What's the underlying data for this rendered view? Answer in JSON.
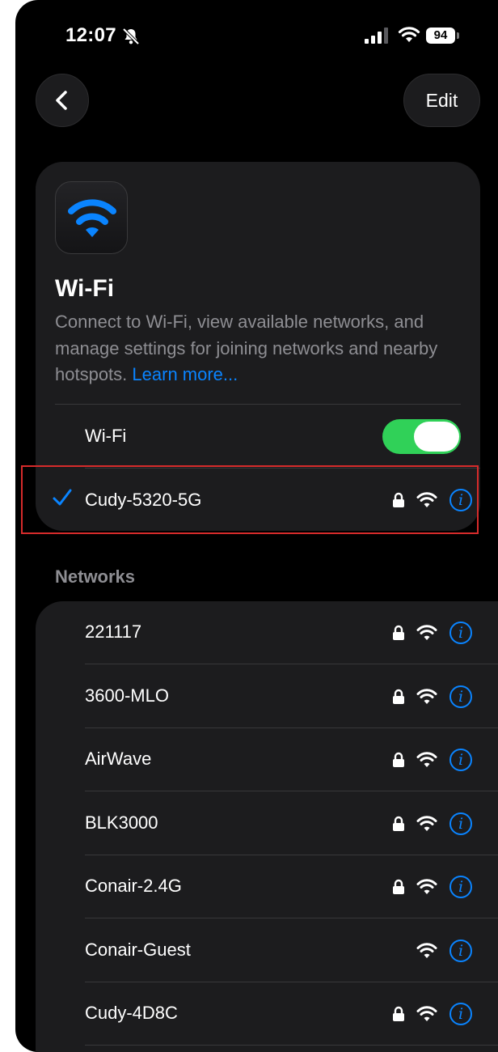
{
  "status_bar": {
    "time": "12:07",
    "battery": "94"
  },
  "nav": {
    "edit_label": "Edit"
  },
  "header_card": {
    "title": "Wi-Fi",
    "description": "Connect to Wi-Fi, view available networks, and manage settings for joining networks and nearby hotspots.",
    "learn_more": "Learn more...",
    "toggle_label": "Wi-Fi",
    "toggle_on": true,
    "connected_network": "Cudy-5320-5G"
  },
  "networks_section": {
    "header": "Networks",
    "items": [
      {
        "name": "221117",
        "locked": true
      },
      {
        "name": "3600-MLO",
        "locked": true
      },
      {
        "name": "AirWave",
        "locked": true
      },
      {
        "name": "BLK3000",
        "locked": true
      },
      {
        "name": "Conair-2.4G",
        "locked": true
      },
      {
        "name": "Conair-Guest",
        "locked": false
      },
      {
        "name": "Cudy-4D8C",
        "locked": true
      }
    ]
  },
  "colors": {
    "accent": "#0a84ff",
    "toggle_on": "#30d158",
    "card_bg": "#1c1c1e",
    "highlight": "#d62b2b"
  }
}
